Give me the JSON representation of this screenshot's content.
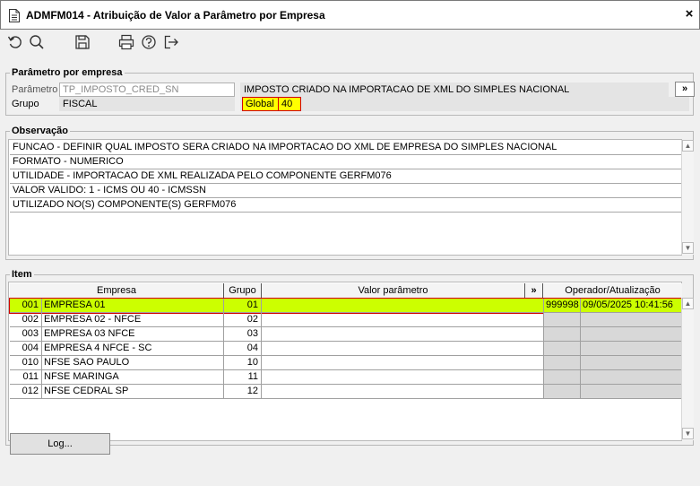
{
  "window": {
    "title": "ADMFM014 - Atribuição de Valor a Parâmetro por Empresa",
    "close_glyph": "×"
  },
  "toolbar": {
    "icons": [
      "undo-icon",
      "search-icon",
      "save-icon",
      "print-icon",
      "help-icon",
      "exit-icon"
    ]
  },
  "parametro_section": {
    "legend": "Parâmetro por empresa",
    "parametro_label": "Parâmetro",
    "parametro_value": "TP_IMPOSTO_CRED_SN",
    "descricao": "IMPOSTO CRIADO NA IMPORTACAO DE XML DO SIMPLES NACIONAL",
    "expand_label": "»",
    "grupo_label": "Grupo",
    "grupo_value": "FISCAL",
    "global_label": "Global",
    "global_value": "40"
  },
  "observacao_section": {
    "legend": "Observação",
    "lines": [
      "FUNCAO - DEFINIR QUAL IMPOSTO SERA CRIADO NA IMPORTACAO DO XML DE EMPRESA DO SIMPLES NACIONAL",
      "FORMATO - NUMERICO",
      "UTILIDADE - IMPORTACAO DE XML REALIZADA PELO COMPONENTE GERFM076",
      "VALOR VALIDO: 1 - ICMS OU 40 - ICMSSN",
      "UTILIZADO NO(S) COMPONENTE(S) GERFM076"
    ]
  },
  "item_section": {
    "legend": "Item",
    "columns": {
      "empresa": "Empresa",
      "grupo": "Grupo",
      "valor": "Valor parâmetro",
      "expand": "»",
      "operador": "Operador/Atualização"
    },
    "rows": [
      {
        "cod": "001",
        "nome": "EMPRESA 01",
        "grupo": "01",
        "valor": "",
        "operador": "999998",
        "atualizacao": "09/05/2025 10:41:56",
        "selected": true
      },
      {
        "cod": "002",
        "nome": "EMPRESA 02 - NFCE",
        "grupo": "02",
        "valor": "",
        "operador": "",
        "atualizacao": ""
      },
      {
        "cod": "003",
        "nome": "EMPRESA 03 NFCE",
        "grupo": "03",
        "valor": "",
        "operador": "",
        "atualizacao": ""
      },
      {
        "cod": "004",
        "nome": "EMPRESA 4 NFCE - SC",
        "grupo": "04",
        "valor": "",
        "operador": "",
        "atualizacao": ""
      },
      {
        "cod": "010",
        "nome": "NFSE SAO PAULO",
        "grupo": "10",
        "valor": "",
        "operador": "",
        "atualizacao": ""
      },
      {
        "cod": "011",
        "nome": "NFSE MARINGA",
        "grupo": "11",
        "valor": "",
        "operador": "",
        "atualizacao": ""
      },
      {
        "cod": "012",
        "nome": "NFSE CEDRAL SP",
        "grupo": "12",
        "valor": "",
        "operador": "",
        "atualizacao": ""
      }
    ]
  },
  "footer": {
    "log_button": "Log..."
  }
}
